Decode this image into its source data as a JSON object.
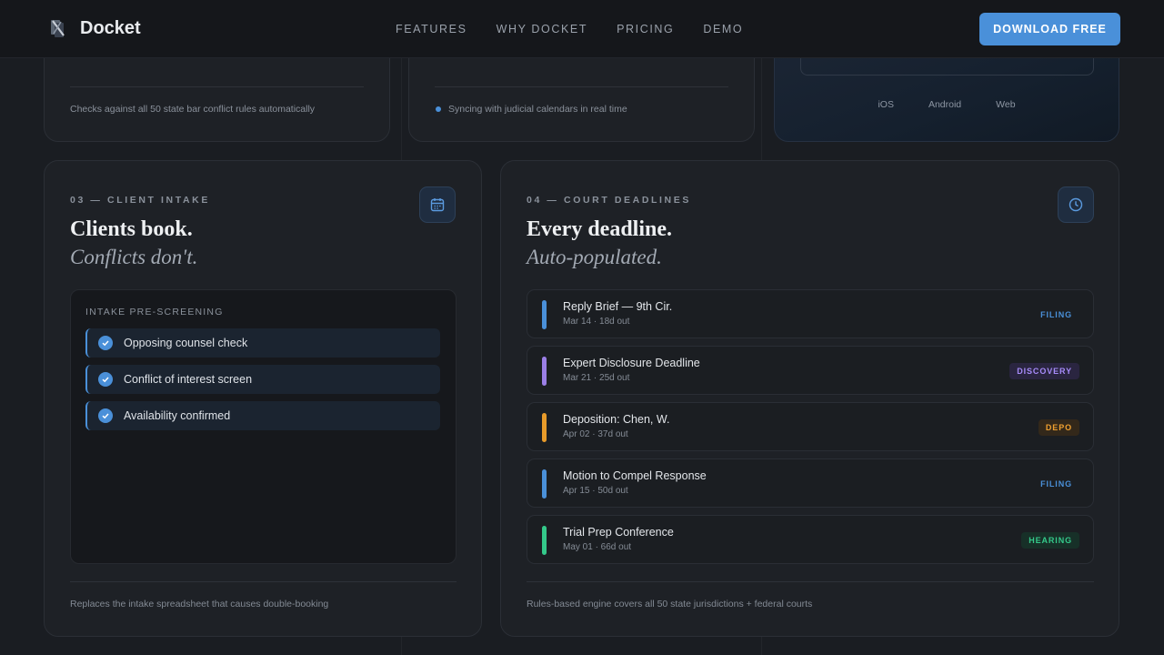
{
  "nav": {
    "brand": "Docket",
    "links": [
      "FEATURES",
      "WHY DOCKET",
      "PRICING",
      "DEMO"
    ],
    "cta": "DOWNLOAD FREE"
  },
  "top_cards": {
    "card1_note": "Checks against all 50 state bar conflict rules automatically",
    "card2_note": "Syncing with judicial calendars in real time",
    "platforms": [
      "iOS",
      "Android",
      "Web"
    ]
  },
  "intake_card": {
    "eyebrow": "03 — CLIENT INTAKE",
    "title": "Clients book.",
    "subtitle": "Conflicts don't.",
    "panel_title": "INTAKE PRE-SCREENING",
    "checks": [
      "Opposing counsel check",
      "Conflict of interest screen",
      "Availability confirmed"
    ],
    "footnote": "Replaces the intake spreadsheet that causes double-booking",
    "icon": "calendar-icon"
  },
  "deadline_card": {
    "eyebrow": "04 — COURT DEADLINES",
    "title": "Every deadline.",
    "subtitle": "Auto-populated.",
    "icon": "clock-icon",
    "items": [
      {
        "title": "Reply Brief — 9th Cir.",
        "meta": "Mar 14 · 18d out",
        "tag": "FILING",
        "color": "#4a90d9",
        "tag_bg": "transparent",
        "tag_color": "#4a90d9"
      },
      {
        "title": "Expert Disclosure Deadline",
        "meta": "Mar 21 · 25d out",
        "tag": "DISCOVERY",
        "color": "#9b7fe6",
        "tag_bg": "#2a2540",
        "tag_color": "#a78bfa"
      },
      {
        "title": "Deposition: Chen, W.",
        "meta": "Apr 02 · 37d out",
        "tag": "DEPO",
        "color": "#e89b2a",
        "tag_bg": "#33281a",
        "tag_color": "#f0a030"
      },
      {
        "title": "Motion to Compel Response",
        "meta": "Apr 15 · 50d out",
        "tag": "FILING",
        "color": "#4a90d9",
        "tag_bg": "transparent",
        "tag_color": "#4a90d9"
      },
      {
        "title": "Trial Prep Conference",
        "meta": "May 01 · 66d out",
        "tag": "HEARING",
        "color": "#34c98a",
        "tag_bg": "#173028",
        "tag_color": "#34c98a"
      }
    ],
    "footnote": "Rules-based engine covers all 50 state jurisdictions + federal courts"
  }
}
